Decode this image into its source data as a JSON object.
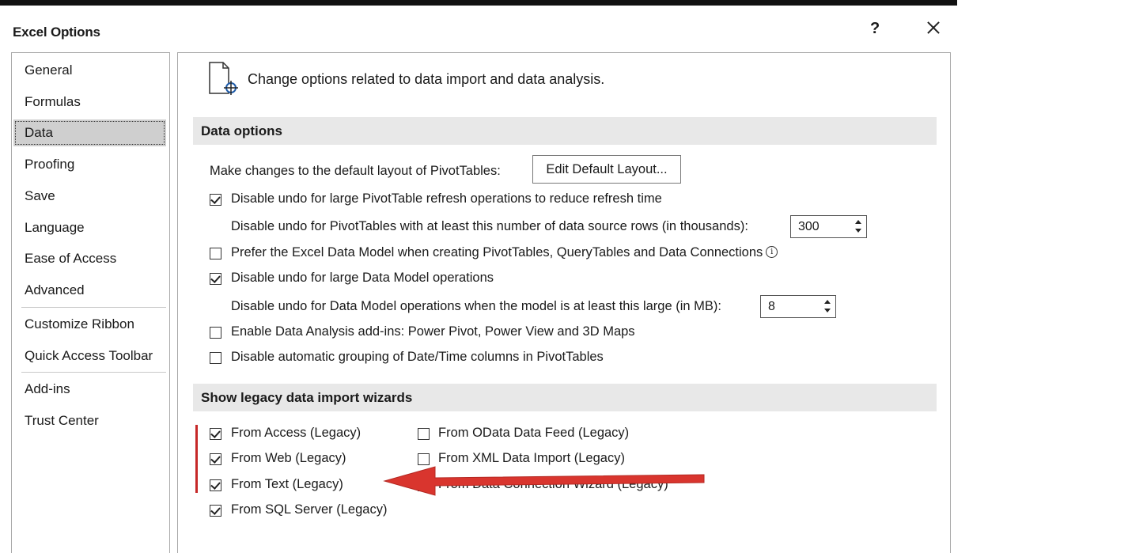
{
  "window": {
    "title": "Excel Options",
    "help_label": "?"
  },
  "nav": {
    "items": [
      {
        "label": "General"
      },
      {
        "label": "Formulas"
      },
      {
        "label": "Data"
      },
      {
        "label": "Proofing"
      },
      {
        "label": "Save"
      },
      {
        "label": "Language"
      },
      {
        "label": "Ease of Access"
      },
      {
        "label": "Advanced"
      },
      {
        "label": "Customize Ribbon"
      },
      {
        "label": "Quick Access Toolbar"
      },
      {
        "label": "Add-ins"
      },
      {
        "label": "Trust Center"
      }
    ],
    "active": "Data"
  },
  "header": {
    "text": "Change options related to data import and data analysis."
  },
  "data_options": {
    "title": "Data options",
    "pivot_layout_label": "Make changes to the default layout of PivotTables:",
    "edit_layout_button": "Edit Default Layout...",
    "disable_undo_pivot": {
      "label": "Disable undo for large PivotTable refresh operations to reduce refresh time",
      "checked": true
    },
    "undo_rows_label": "Disable undo for PivotTables with at least this number of data source rows (in thousands):",
    "undo_rows_value": "300",
    "prefer_data_model": {
      "label": "Prefer the Excel Data Model when creating PivotTables, QueryTables and Data Connections",
      "checked": false
    },
    "info_glyph": "i",
    "disable_undo_model": {
      "label": "Disable undo for large Data Model operations",
      "checked": true
    },
    "undo_model_label": "Disable undo for Data Model operations when the model is at least this large (in MB):",
    "undo_model_value": "8",
    "enable_addins": {
      "label": "Enable Data Analysis add-ins: Power Pivot, Power View and 3D Maps",
      "checked": false
    },
    "disable_grouping": {
      "label": "Disable automatic grouping of Date/Time columns in PivotTables",
      "checked": false
    }
  },
  "legacy": {
    "title": "Show legacy data import wizards",
    "left": [
      {
        "label": "From Access (Legacy)",
        "checked": true
      },
      {
        "label": "From Web (Legacy)",
        "checked": true
      },
      {
        "label": "From Text (Legacy)",
        "checked": true
      },
      {
        "label": "From SQL Server (Legacy)",
        "checked": true
      }
    ],
    "right": [
      {
        "label": "From OData Data Feed (Legacy)",
        "checked": false
      },
      {
        "label": "From XML Data Import (Legacy)",
        "checked": false
      },
      {
        "label": "From Data Connection Wizard (Legacy)",
        "checked": false
      }
    ]
  },
  "annotation": {
    "arrow_color": "#d32f2f",
    "bar_color": "#c62828",
    "icon": "data-options-icon"
  }
}
